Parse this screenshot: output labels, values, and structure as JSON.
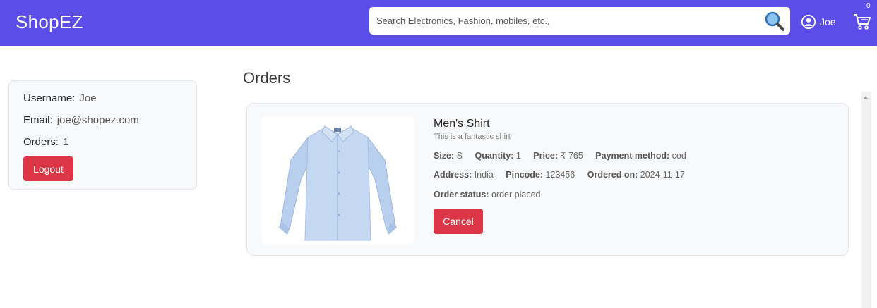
{
  "header": {
    "brand": "ShopEZ",
    "search_placeholder": "Search Electronics, Fashion, mobiles, etc.,",
    "user_name": "Joe",
    "cart_count": "0"
  },
  "profile": {
    "username_label": "Username:",
    "username": "Joe",
    "email_label": "Email:",
    "email": "joe@shopez.com",
    "orders_label": "Orders:",
    "orders_count": "1",
    "logout_label": "Logout"
  },
  "orders": {
    "title": "Orders",
    "items": [
      {
        "name": "Men's Shirt",
        "description": "This is a fantastic shirt",
        "size_label": "Size:",
        "size": "S",
        "quantity_label": "Quantity:",
        "quantity": "1",
        "price_label": "Price:",
        "price": "₹ 765",
        "payment_label": "Payment method:",
        "payment": "cod",
        "address_label": "Address:",
        "address": "India",
        "pincode_label": "Pincode:",
        "pincode": "123456",
        "ordered_on_label": "Ordered on:",
        "ordered_on": "2024-11-17",
        "status_label": "Order status:",
        "status": "order placed",
        "cancel_label": "Cancel"
      }
    ]
  },
  "colors": {
    "navbar": "#5b4de8",
    "danger": "#dc3545",
    "card_bg": "#f8f9fa"
  },
  "icons": {
    "search": "search-icon",
    "user": "user-circle-icon",
    "cart": "cart-icon"
  }
}
